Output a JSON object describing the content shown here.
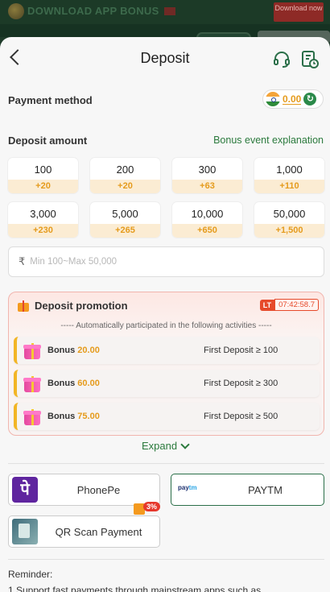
{
  "banner": {
    "download_text": "DOWNLOAD APP  BONUS",
    "download_button": "Download now"
  },
  "header": {
    "title": "Deposit"
  },
  "payment_method": {
    "label": "Payment method",
    "balance": "0.00"
  },
  "deposit_amount": {
    "label": "Deposit amount",
    "bonus_link": "Bonus event explanation",
    "amounts": [
      {
        "value": "100",
        "bonus": "+20"
      },
      {
        "value": "200",
        "bonus": "+20"
      },
      {
        "value": "300",
        "bonus": "+63"
      },
      {
        "value": "1,000",
        "bonus": "+110"
      },
      {
        "value": "3,000",
        "bonus": "+230"
      },
      {
        "value": "5,000",
        "bonus": "+265"
      },
      {
        "value": "10,000",
        "bonus": "+650"
      },
      {
        "value": "50,000",
        "bonus": "+1,500"
      }
    ]
  },
  "amount_input": {
    "currency": "₹",
    "placeholder": "Min 100~Max 50,000"
  },
  "promotion": {
    "title": "Deposit promotion",
    "badge": "LT",
    "countdown": "07:42:58.7",
    "subtitle": "----- Automatically participated in the following activities -----",
    "rows": [
      {
        "bonus_label": "Bonus",
        "bonus_amount": "20.00",
        "condition": "First Deposit ≥ 100"
      },
      {
        "bonus_label": "Bonus",
        "bonus_amount": "60.00",
        "condition": "First Deposit ≥ 300"
      },
      {
        "bonus_label": "Bonus",
        "bonus_amount": "75.00",
        "condition": "First Deposit ≥ 500"
      }
    ]
  },
  "expand_label": "Expand",
  "payment_options": {
    "phonepe": "PhonePe",
    "paytm": "PAYTM",
    "paytm_logo_main": "pay",
    "paytm_logo_accent": "tm",
    "qr": "QR Scan Payment",
    "qr_promo": "3%",
    "selected": "PAYTM"
  },
  "reminder": {
    "title": "Reminder:",
    "line1": "1.Support fast payments through mainstream apps such as"
  },
  "colors": {
    "accent_green": "#2b7a3d",
    "bonus_orange": "#e59b1c",
    "promo_red": "#e64a2b"
  }
}
